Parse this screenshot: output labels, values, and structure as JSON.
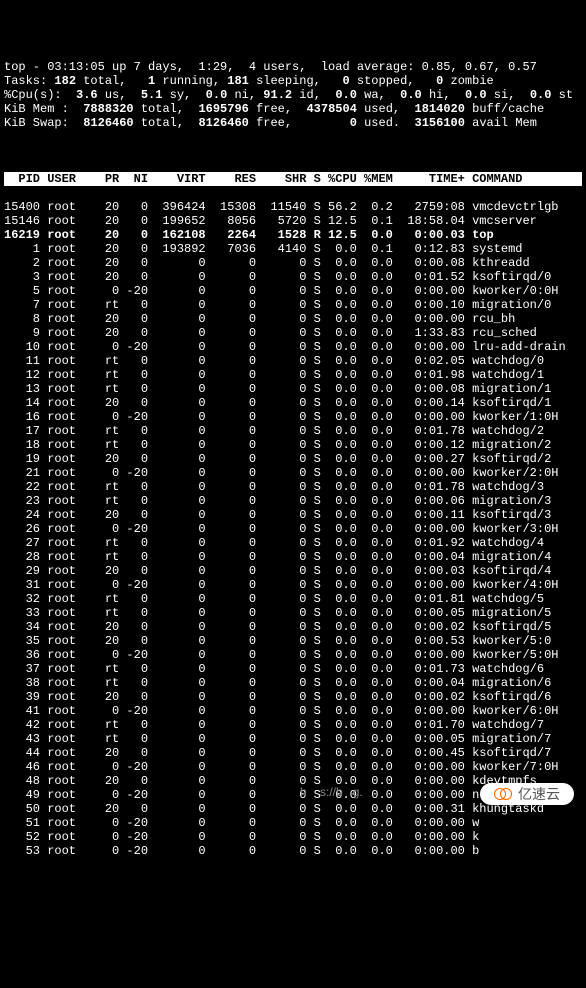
{
  "summary": {
    "line1": "top - 03:13:05 up 7 days,  1:29,  4 users,  load average: 0.85, 0.67, 0.57",
    "tasks_label": "Tasks:",
    "tasks_total": "182",
    "tasks_running": "1",
    "tasks_sleeping": "181",
    "tasks_stopped": "0",
    "tasks_zombie": "0",
    "cpu_label": "%Cpu(s):",
    "cpu_us": "3.6",
    "cpu_sy": "5.1",
    "cpu_ni": "0.0",
    "cpu_id": "91.2",
    "cpu_wa": "0.0",
    "cpu_hi": "0.0",
    "cpu_si": "0.0",
    "cpu_st": "0.0",
    "mem_label": "KiB Mem :",
    "mem_total": "7888320",
    "mem_free": "1695796",
    "mem_used": "4378504",
    "mem_buff": "1814020",
    "swap_label": "KiB Swap:",
    "swap_total": "8126460",
    "swap_free": "8126460",
    "swap_used": "0",
    "swap_avail": "3156100"
  },
  "columns": [
    "PID",
    "USER",
    "PR",
    "NI",
    "VIRT",
    "RES",
    "SHR",
    "S",
    "%CPU",
    "%MEM",
    "TIME+",
    "COMMAND"
  ],
  "processes": [
    {
      "pid": "15400",
      "user": "root",
      "pr": "20",
      "ni": "0",
      "virt": "396424",
      "res": "15308",
      "shr": "11540",
      "s": "S",
      "cpu": "56.2",
      "mem": "0.2",
      "time": "2759:08",
      "cmd": "vmcdevctrlgb",
      "hl": false
    },
    {
      "pid": "15146",
      "user": "root",
      "pr": "20",
      "ni": "0",
      "virt": "199652",
      "res": "8056",
      "shr": "5720",
      "s": "S",
      "cpu": "12.5",
      "mem": "0.1",
      "time": "18:58.04",
      "cmd": "vmcserver",
      "hl": false
    },
    {
      "pid": "16219",
      "user": "root",
      "pr": "20",
      "ni": "0",
      "virt": "162108",
      "res": "2264",
      "shr": "1528",
      "s": "R",
      "cpu": "12.5",
      "mem": "0.0",
      "time": "0:00.03",
      "cmd": "top",
      "hl": true
    },
    {
      "pid": "1",
      "user": "root",
      "pr": "20",
      "ni": "0",
      "virt": "193892",
      "res": "7036",
      "shr": "4140",
      "s": "S",
      "cpu": "0.0",
      "mem": "0.1",
      "time": "0:12.83",
      "cmd": "systemd",
      "hl": false
    },
    {
      "pid": "2",
      "user": "root",
      "pr": "20",
      "ni": "0",
      "virt": "0",
      "res": "0",
      "shr": "0",
      "s": "S",
      "cpu": "0.0",
      "mem": "0.0",
      "time": "0:00.08",
      "cmd": "kthreadd",
      "hl": false
    },
    {
      "pid": "3",
      "user": "root",
      "pr": "20",
      "ni": "0",
      "virt": "0",
      "res": "0",
      "shr": "0",
      "s": "S",
      "cpu": "0.0",
      "mem": "0.0",
      "time": "0:01.52",
      "cmd": "ksoftirqd/0",
      "hl": false
    },
    {
      "pid": "5",
      "user": "root",
      "pr": "0",
      "ni": "-20",
      "virt": "0",
      "res": "0",
      "shr": "0",
      "s": "S",
      "cpu": "0.0",
      "mem": "0.0",
      "time": "0:00.00",
      "cmd": "kworker/0:0H",
      "hl": false
    },
    {
      "pid": "7",
      "user": "root",
      "pr": "rt",
      "ni": "0",
      "virt": "0",
      "res": "0",
      "shr": "0",
      "s": "S",
      "cpu": "0.0",
      "mem": "0.0",
      "time": "0:00.10",
      "cmd": "migration/0",
      "hl": false
    },
    {
      "pid": "8",
      "user": "root",
      "pr": "20",
      "ni": "0",
      "virt": "0",
      "res": "0",
      "shr": "0",
      "s": "S",
      "cpu": "0.0",
      "mem": "0.0",
      "time": "0:00.00",
      "cmd": "rcu_bh",
      "hl": false
    },
    {
      "pid": "9",
      "user": "root",
      "pr": "20",
      "ni": "0",
      "virt": "0",
      "res": "0",
      "shr": "0",
      "s": "S",
      "cpu": "0.0",
      "mem": "0.0",
      "time": "1:33.83",
      "cmd": "rcu_sched",
      "hl": false
    },
    {
      "pid": "10",
      "user": "root",
      "pr": "0",
      "ni": "-20",
      "virt": "0",
      "res": "0",
      "shr": "0",
      "s": "S",
      "cpu": "0.0",
      "mem": "0.0",
      "time": "0:00.00",
      "cmd": "lru-add-drain",
      "hl": false
    },
    {
      "pid": "11",
      "user": "root",
      "pr": "rt",
      "ni": "0",
      "virt": "0",
      "res": "0",
      "shr": "0",
      "s": "S",
      "cpu": "0.0",
      "mem": "0.0",
      "time": "0:02.05",
      "cmd": "watchdog/0",
      "hl": false
    },
    {
      "pid": "12",
      "user": "root",
      "pr": "rt",
      "ni": "0",
      "virt": "0",
      "res": "0",
      "shr": "0",
      "s": "S",
      "cpu": "0.0",
      "mem": "0.0",
      "time": "0:01.98",
      "cmd": "watchdog/1",
      "hl": false
    },
    {
      "pid": "13",
      "user": "root",
      "pr": "rt",
      "ni": "0",
      "virt": "0",
      "res": "0",
      "shr": "0",
      "s": "S",
      "cpu": "0.0",
      "mem": "0.0",
      "time": "0:00.08",
      "cmd": "migration/1",
      "hl": false
    },
    {
      "pid": "14",
      "user": "root",
      "pr": "20",
      "ni": "0",
      "virt": "0",
      "res": "0",
      "shr": "0",
      "s": "S",
      "cpu": "0.0",
      "mem": "0.0",
      "time": "0:00.14",
      "cmd": "ksoftirqd/1",
      "hl": false
    },
    {
      "pid": "16",
      "user": "root",
      "pr": "0",
      "ni": "-20",
      "virt": "0",
      "res": "0",
      "shr": "0",
      "s": "S",
      "cpu": "0.0",
      "mem": "0.0",
      "time": "0:00.00",
      "cmd": "kworker/1:0H",
      "hl": false
    },
    {
      "pid": "17",
      "user": "root",
      "pr": "rt",
      "ni": "0",
      "virt": "0",
      "res": "0",
      "shr": "0",
      "s": "S",
      "cpu": "0.0",
      "mem": "0.0",
      "time": "0:01.78",
      "cmd": "watchdog/2",
      "hl": false
    },
    {
      "pid": "18",
      "user": "root",
      "pr": "rt",
      "ni": "0",
      "virt": "0",
      "res": "0",
      "shr": "0",
      "s": "S",
      "cpu": "0.0",
      "mem": "0.0",
      "time": "0:00.12",
      "cmd": "migration/2",
      "hl": false
    },
    {
      "pid": "19",
      "user": "root",
      "pr": "20",
      "ni": "0",
      "virt": "0",
      "res": "0",
      "shr": "0",
      "s": "S",
      "cpu": "0.0",
      "mem": "0.0",
      "time": "0:00.27",
      "cmd": "ksoftirqd/2",
      "hl": false
    },
    {
      "pid": "21",
      "user": "root",
      "pr": "0",
      "ni": "-20",
      "virt": "0",
      "res": "0",
      "shr": "0",
      "s": "S",
      "cpu": "0.0",
      "mem": "0.0",
      "time": "0:00.00",
      "cmd": "kworker/2:0H",
      "hl": false
    },
    {
      "pid": "22",
      "user": "root",
      "pr": "rt",
      "ni": "0",
      "virt": "0",
      "res": "0",
      "shr": "0",
      "s": "S",
      "cpu": "0.0",
      "mem": "0.0",
      "time": "0:01.78",
      "cmd": "watchdog/3",
      "hl": false
    },
    {
      "pid": "23",
      "user": "root",
      "pr": "rt",
      "ni": "0",
      "virt": "0",
      "res": "0",
      "shr": "0",
      "s": "S",
      "cpu": "0.0",
      "mem": "0.0",
      "time": "0:00.06",
      "cmd": "migration/3",
      "hl": false
    },
    {
      "pid": "24",
      "user": "root",
      "pr": "20",
      "ni": "0",
      "virt": "0",
      "res": "0",
      "shr": "0",
      "s": "S",
      "cpu": "0.0",
      "mem": "0.0",
      "time": "0:00.11",
      "cmd": "ksoftirqd/3",
      "hl": false
    },
    {
      "pid": "26",
      "user": "root",
      "pr": "0",
      "ni": "-20",
      "virt": "0",
      "res": "0",
      "shr": "0",
      "s": "S",
      "cpu": "0.0",
      "mem": "0.0",
      "time": "0:00.00",
      "cmd": "kworker/3:0H",
      "hl": false
    },
    {
      "pid": "27",
      "user": "root",
      "pr": "rt",
      "ni": "0",
      "virt": "0",
      "res": "0",
      "shr": "0",
      "s": "S",
      "cpu": "0.0",
      "mem": "0.0",
      "time": "0:01.92",
      "cmd": "watchdog/4",
      "hl": false
    },
    {
      "pid": "28",
      "user": "root",
      "pr": "rt",
      "ni": "0",
      "virt": "0",
      "res": "0",
      "shr": "0",
      "s": "S",
      "cpu": "0.0",
      "mem": "0.0",
      "time": "0:00.04",
      "cmd": "migration/4",
      "hl": false
    },
    {
      "pid": "29",
      "user": "root",
      "pr": "20",
      "ni": "0",
      "virt": "0",
      "res": "0",
      "shr": "0",
      "s": "S",
      "cpu": "0.0",
      "mem": "0.0",
      "time": "0:00.03",
      "cmd": "ksoftirqd/4",
      "hl": false
    },
    {
      "pid": "31",
      "user": "root",
      "pr": "0",
      "ni": "-20",
      "virt": "0",
      "res": "0",
      "shr": "0",
      "s": "S",
      "cpu": "0.0",
      "mem": "0.0",
      "time": "0:00.00",
      "cmd": "kworker/4:0H",
      "hl": false
    },
    {
      "pid": "32",
      "user": "root",
      "pr": "rt",
      "ni": "0",
      "virt": "0",
      "res": "0",
      "shr": "0",
      "s": "S",
      "cpu": "0.0",
      "mem": "0.0",
      "time": "0:01.81",
      "cmd": "watchdog/5",
      "hl": false
    },
    {
      "pid": "33",
      "user": "root",
      "pr": "rt",
      "ni": "0",
      "virt": "0",
      "res": "0",
      "shr": "0",
      "s": "S",
      "cpu": "0.0",
      "mem": "0.0",
      "time": "0:00.05",
      "cmd": "migration/5",
      "hl": false
    },
    {
      "pid": "34",
      "user": "root",
      "pr": "20",
      "ni": "0",
      "virt": "0",
      "res": "0",
      "shr": "0",
      "s": "S",
      "cpu": "0.0",
      "mem": "0.0",
      "time": "0:00.02",
      "cmd": "ksoftirqd/5",
      "hl": false
    },
    {
      "pid": "35",
      "user": "root",
      "pr": "20",
      "ni": "0",
      "virt": "0",
      "res": "0",
      "shr": "0",
      "s": "S",
      "cpu": "0.0",
      "mem": "0.0",
      "time": "0:00.53",
      "cmd": "kworker/5:0",
      "hl": false
    },
    {
      "pid": "36",
      "user": "root",
      "pr": "0",
      "ni": "-20",
      "virt": "0",
      "res": "0",
      "shr": "0",
      "s": "S",
      "cpu": "0.0",
      "mem": "0.0",
      "time": "0:00.00",
      "cmd": "kworker/5:0H",
      "hl": false
    },
    {
      "pid": "37",
      "user": "root",
      "pr": "rt",
      "ni": "0",
      "virt": "0",
      "res": "0",
      "shr": "0",
      "s": "S",
      "cpu": "0.0",
      "mem": "0.0",
      "time": "0:01.73",
      "cmd": "watchdog/6",
      "hl": false
    },
    {
      "pid": "38",
      "user": "root",
      "pr": "rt",
      "ni": "0",
      "virt": "0",
      "res": "0",
      "shr": "0",
      "s": "S",
      "cpu": "0.0",
      "mem": "0.0",
      "time": "0:00.04",
      "cmd": "migration/6",
      "hl": false
    },
    {
      "pid": "39",
      "user": "root",
      "pr": "20",
      "ni": "0",
      "virt": "0",
      "res": "0",
      "shr": "0",
      "s": "S",
      "cpu": "0.0",
      "mem": "0.0",
      "time": "0:00.02",
      "cmd": "ksoftirqd/6",
      "hl": false
    },
    {
      "pid": "41",
      "user": "root",
      "pr": "0",
      "ni": "-20",
      "virt": "0",
      "res": "0",
      "shr": "0",
      "s": "S",
      "cpu": "0.0",
      "mem": "0.0",
      "time": "0:00.00",
      "cmd": "kworker/6:0H",
      "hl": false
    },
    {
      "pid": "42",
      "user": "root",
      "pr": "rt",
      "ni": "0",
      "virt": "0",
      "res": "0",
      "shr": "0",
      "s": "S",
      "cpu": "0.0",
      "mem": "0.0",
      "time": "0:01.70",
      "cmd": "watchdog/7",
      "hl": false
    },
    {
      "pid": "43",
      "user": "root",
      "pr": "rt",
      "ni": "0",
      "virt": "0",
      "res": "0",
      "shr": "0",
      "s": "S",
      "cpu": "0.0",
      "mem": "0.0",
      "time": "0:00.05",
      "cmd": "migration/7",
      "hl": false
    },
    {
      "pid": "44",
      "user": "root",
      "pr": "20",
      "ni": "0",
      "virt": "0",
      "res": "0",
      "shr": "0",
      "s": "S",
      "cpu": "0.0",
      "mem": "0.0",
      "time": "0:00.45",
      "cmd": "ksoftirqd/7",
      "hl": false
    },
    {
      "pid": "46",
      "user": "root",
      "pr": "0",
      "ni": "-20",
      "virt": "0",
      "res": "0",
      "shr": "0",
      "s": "S",
      "cpu": "0.0",
      "mem": "0.0",
      "time": "0:00.00",
      "cmd": "kworker/7:0H",
      "hl": false
    },
    {
      "pid": "48",
      "user": "root",
      "pr": "20",
      "ni": "0",
      "virt": "0",
      "res": "0",
      "shr": "0",
      "s": "S",
      "cpu": "0.0",
      "mem": "0.0",
      "time": "0:00.00",
      "cmd": "kdevtmpfs",
      "hl": false
    },
    {
      "pid": "49",
      "user": "root",
      "pr": "0",
      "ni": "-20",
      "virt": "0",
      "res": "0",
      "shr": "0",
      "s": "S",
      "cpu": "0.0",
      "mem": "0.0",
      "time": "0:00.00",
      "cmd": "netns",
      "hl": false
    },
    {
      "pid": "50",
      "user": "root",
      "pr": "20",
      "ni": "0",
      "virt": "0",
      "res": "0",
      "shr": "0",
      "s": "S",
      "cpu": "0.0",
      "mem": "0.0",
      "time": "0:00.31",
      "cmd": "khungtaskd",
      "hl": false
    },
    {
      "pid": "51",
      "user": "root",
      "pr": "0",
      "ni": "-20",
      "virt": "0",
      "res": "0",
      "shr": "0",
      "s": "S",
      "cpu": "0.0",
      "mem": "0.0",
      "time": "0:00.00",
      "cmd": "w",
      "hl": false
    },
    {
      "pid": "52",
      "user": "root",
      "pr": "0",
      "ni": "-20",
      "virt": "0",
      "res": "0",
      "shr": "0",
      "s": "S",
      "cpu": "0.0",
      "mem": "0.0",
      "time": "0:00.00",
      "cmd": "k",
      "hl": false
    },
    {
      "pid": "53",
      "user": "root",
      "pr": "0",
      "ni": "-20",
      "virt": "0",
      "res": "0",
      "shr": "0",
      "s": "S",
      "cpu": "0.0",
      "mem": "0.0",
      "time": "0:00.00",
      "cmd": "b",
      "hl": false
    }
  ],
  "watermark": "亿速云",
  "url_fragment": "h    s://b   g."
}
